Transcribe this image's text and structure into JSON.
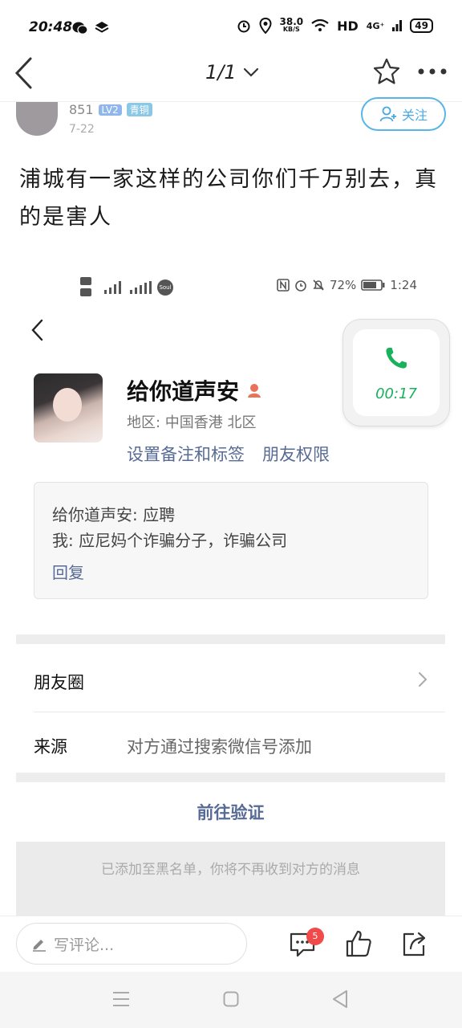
{
  "status_bar": {
    "time": "20:48",
    "speed_value": "38.0",
    "speed_unit": "KB/S",
    "network": "HD",
    "signal": "4G⁺",
    "battery": "49"
  },
  "nav": {
    "pager": "1/1"
  },
  "post": {
    "username": "851",
    "level": "LV2",
    "rank": "青铜",
    "date": "7-22",
    "follow_label": "关注",
    "text": "浦城有一家这样的公司你们千万别去，真的是害人"
  },
  "screenshot": {
    "status": {
      "battery_pct": "72%",
      "time": "1:24",
      "carrier": "Soul"
    },
    "profile_name": "给你道声安",
    "region": "地区: 中国香港  北区",
    "link_notes": "设置备注和标签",
    "link_perm": "朋友权限",
    "call_duration": "00:17",
    "msg_line1": "给你道声安: 应聘",
    "msg_line2": "我: 应尼妈个诈骗分子，诈骗公司",
    "reply": "回复",
    "moments": "朋友圈",
    "source_label": "来源",
    "source_value": "对方通过搜索微信号添加",
    "verify": "前往验证",
    "blacklist_note": "已添加至黑名单，你将不再收到对方的消息"
  },
  "comment_bar": {
    "placeholder": "写评论...",
    "comment_count": "5"
  },
  "colors": {
    "accent_blue": "#576b95",
    "follow_blue": "#4aa8e2",
    "call_green": "#19b15c",
    "badge_red": "#f04a4a"
  }
}
